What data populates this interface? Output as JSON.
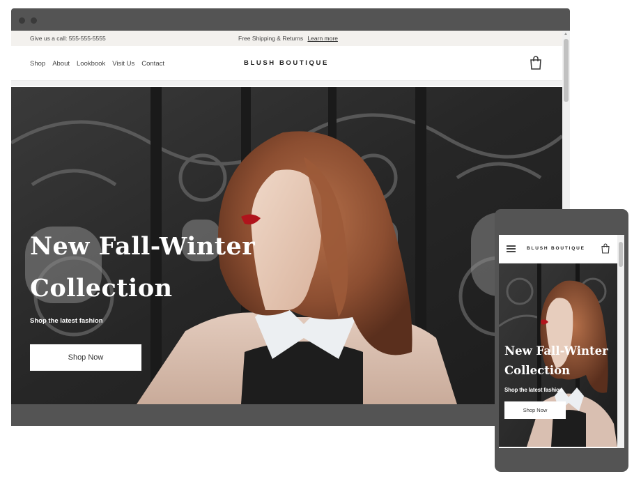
{
  "announcement": {
    "call_text": "Give us a call: 555-555-5555",
    "shipping_text": "Free Shipping & Returns",
    "learn_more": "Learn more"
  },
  "nav": {
    "items": [
      {
        "label": "Shop"
      },
      {
        "label": "About"
      },
      {
        "label": "Lookbook"
      },
      {
        "label": "Visit Us"
      },
      {
        "label": "Contact"
      }
    ],
    "brand": "BLUSH BOUTIQUE",
    "cart_icon": "shopping-bag-icon"
  },
  "hero": {
    "title": "New Fall-Winter Collection",
    "subtitle": "Shop the latest fashion",
    "button": "Shop Now"
  },
  "mobile": {
    "menu_icon": "hamburger-icon",
    "brand": "BLUSH BOUTIQUE",
    "title": "New Fall-Winter Collection",
    "subtitle": "Shop the latest fashion",
    "button": "Shop Now"
  },
  "colors": {
    "device_frame": "#545454",
    "announcement_bg": "#f3f1ee",
    "hero_text": "#ffffff"
  }
}
